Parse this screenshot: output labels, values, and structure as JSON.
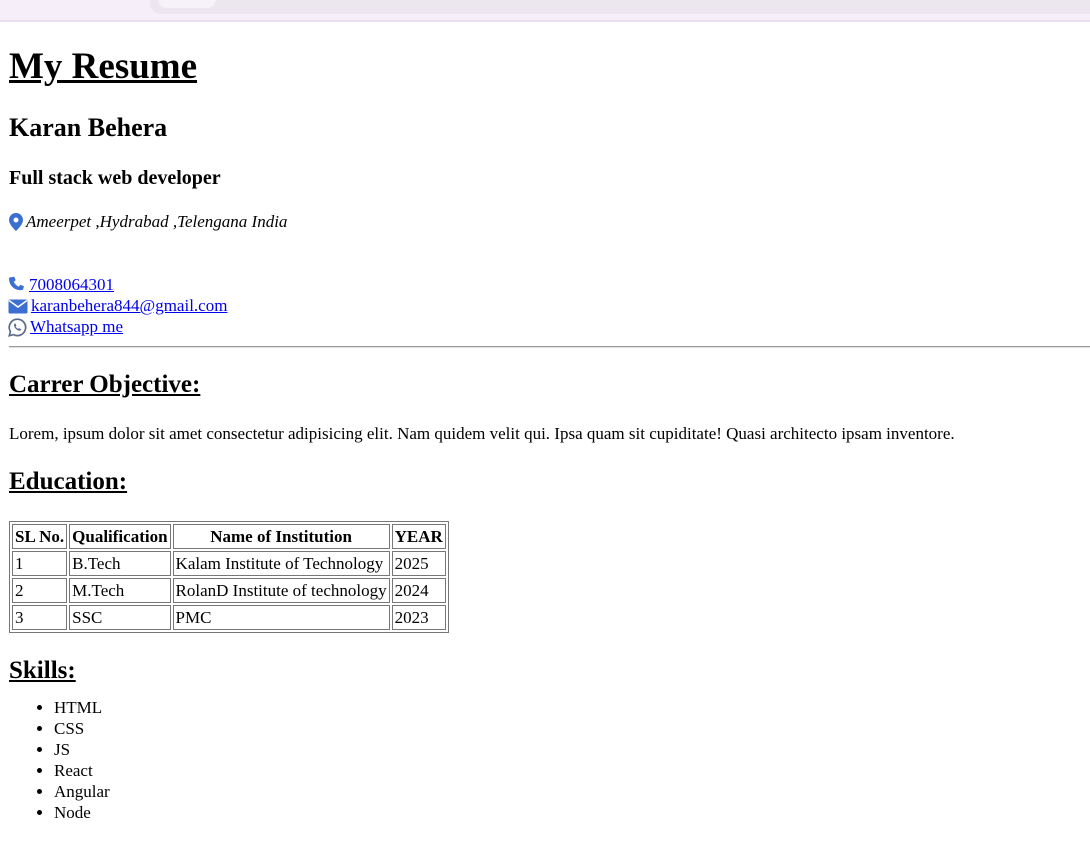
{
  "header": {
    "title": "My Resume",
    "name": "Karan Behera",
    "role": "Full stack web developer",
    "address": "Ameerpet ,Hydrabad ,Telengana India"
  },
  "contacts": [
    {
      "icon": "phone-icon",
      "text": "7008064301"
    },
    {
      "icon": "envelope-icon",
      "text": "karanbehera844@gmail.com"
    },
    {
      "icon": "whatsapp-icon",
      "text": "Whatsapp me"
    }
  ],
  "objective": {
    "heading": "Carrer Objective:",
    "text": "Lorem, ipsum dolor sit amet consectetur adipisicing elit. Nam quidem velit qui. Ipsa quam sit cupiditate! Quasi architecto ipsam inventore."
  },
  "education": {
    "heading": "Education:",
    "columns": [
      "SL No.",
      "Qualification",
      "Name of Institution",
      "YEAR"
    ],
    "rows": [
      [
        "1",
        "B.Tech",
        "Kalam Institute of Technology",
        "2025"
      ],
      [
        "2",
        "M.Tech",
        "RolanD Institute of technology",
        "2024"
      ],
      [
        "3",
        "SSC",
        "PMC",
        "2023"
      ]
    ]
  },
  "skills": {
    "heading": "Skills:",
    "items": [
      "HTML",
      "CSS",
      "JS",
      "React",
      "Angular",
      "Node"
    ]
  },
  "colors": {
    "link": "#0000ee",
    "icon": "#3b6fd1"
  }
}
